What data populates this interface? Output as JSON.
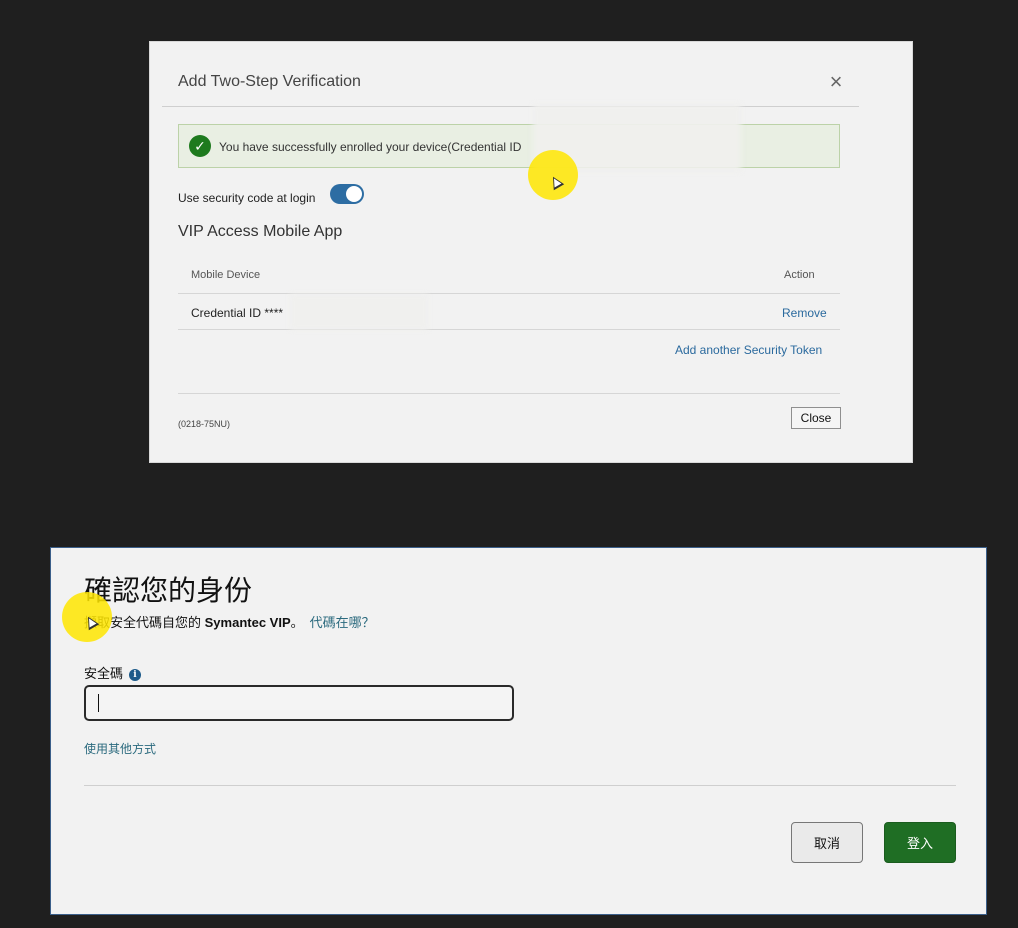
{
  "dialog": {
    "title": "Add Two-Step Verification",
    "close_glyph": "×",
    "success_message": "You have successfully enrolled your device(Credential ID",
    "toggle_label": "Use security code at login",
    "toggle_on": true,
    "section_title": "VIP Access Mobile App",
    "table": {
      "columns": [
        "Mobile Device",
        "Action"
      ],
      "rows": [
        {
          "device": "Credential ID ****",
          "action": "Remove"
        }
      ]
    },
    "add_token_link": "Add another Security Token",
    "code": "(0218-75NU)",
    "close_button": "Close"
  },
  "panel": {
    "title": "確認您的身份",
    "subtitle_prefix": "擷取安全代碼自您的 ",
    "subtitle_brand": "Symantec VIP",
    "subtitle_suffix": "。",
    "where_link": "代碼在哪？",
    "field_label": "安全碼",
    "info_glyph": "i",
    "input_value": "",
    "other_method_link": "使用其他方式",
    "cancel_button": "取消",
    "login_button": "登入"
  },
  "colors": {
    "success_green": "#1e7a1e",
    "toggle_blue": "#2d6da3",
    "link_blue": "#2b6a9e",
    "login_green": "#1f6e24",
    "cursor_highlight": "#ffe600"
  }
}
